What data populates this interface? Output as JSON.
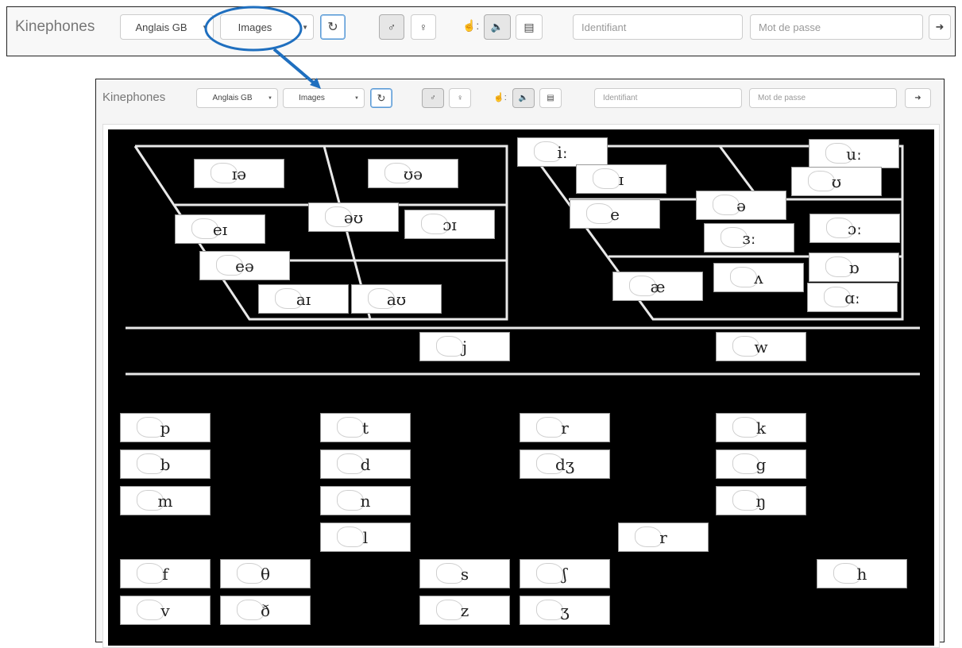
{
  "app": {
    "brand": "Kinephones",
    "language": "Anglais GB",
    "mode": "Images",
    "login_placeholder": "Identifiant",
    "password_placeholder": "Mot de passe"
  },
  "icons": {
    "refresh": "refresh-icon",
    "man": "man-icon",
    "woman": "woman-icon",
    "hand": "hand-icon",
    "sound": "volume-icon",
    "table": "table-icon",
    "login": "sign-in-icon"
  },
  "colors": {
    "accent": "#1f6fbf",
    "board": "#000000",
    "tile": "#ffffff"
  },
  "vowels_left": [
    {
      "sym": "ɪə"
    },
    {
      "sym": "ʊə"
    },
    {
      "sym": "eɪ"
    },
    {
      "sym": "əʊ"
    },
    {
      "sym": "ɔɪ"
    },
    {
      "sym": "eə"
    },
    {
      "sym": "aɪ"
    },
    {
      "sym": "aʊ"
    }
  ],
  "vowels_right": [
    {
      "sym": "iː"
    },
    {
      "sym": "uː"
    },
    {
      "sym": "ɪ"
    },
    {
      "sym": "ʊ"
    },
    {
      "sym": "e"
    },
    {
      "sym": "ə"
    },
    {
      "sym": "ɜː"
    },
    {
      "sym": "ɔː"
    },
    {
      "sym": "æ"
    },
    {
      "sym": "ʌ"
    },
    {
      "sym": "ɒ"
    },
    {
      "sym": "ɑː"
    }
  ],
  "semivowels": [
    {
      "sym": "j"
    },
    {
      "sym": "w"
    }
  ],
  "consonants": [
    {
      "sym": "p"
    },
    {
      "sym": "t"
    },
    {
      "sym": "r"
    },
    {
      "sym": "k"
    },
    {
      "sym": "b"
    },
    {
      "sym": "d"
    },
    {
      "sym": "dʒ"
    },
    {
      "sym": "g"
    },
    {
      "sym": "m"
    },
    {
      "sym": "n"
    },
    {
      "sym": "ŋ"
    },
    {
      "sym": "l"
    },
    {
      "sym": "r"
    },
    {
      "sym": "f"
    },
    {
      "sym": "θ"
    },
    {
      "sym": "s"
    },
    {
      "sym": "ʃ"
    },
    {
      "sym": "h"
    },
    {
      "sym": "v"
    },
    {
      "sym": "ð"
    },
    {
      "sym": "z"
    },
    {
      "sym": "ʒ"
    }
  ]
}
